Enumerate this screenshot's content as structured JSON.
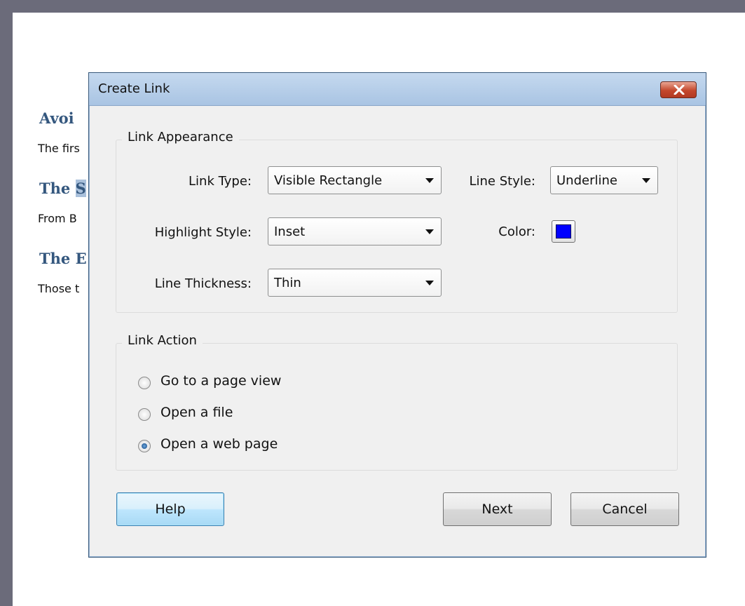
{
  "document": {
    "heading1": "Avoi",
    "para1": "The firs",
    "heading2_a": "The ",
    "heading2_sel": "S",
    "para2": "From B",
    "heading3": "The E",
    "para3": "Those t"
  },
  "dialog": {
    "title": "Create Link",
    "close_icon": "close-x-icon",
    "appearance": {
      "legend": "Link Appearance",
      "link_type_label": "Link Type:",
      "link_type_value": "Visible Rectangle",
      "line_style_label": "Line Style:",
      "line_style_value": "Underline",
      "highlight_style_label": "Highlight Style:",
      "highlight_style_value": "Inset",
      "color_label": "Color:",
      "color_value": "#0000ff",
      "line_thickness_label": "Line Thickness:",
      "line_thickness_value": "Thin"
    },
    "action": {
      "legend": "Link Action",
      "options": [
        {
          "label": "Go to a page view",
          "selected": false
        },
        {
          "label": "Open a file",
          "selected": false
        },
        {
          "label": "Open a web page",
          "selected": true
        }
      ]
    },
    "buttons": {
      "help": "Help",
      "next": "Next",
      "cancel": "Cancel"
    }
  },
  "colors": {
    "accent": "#3c7fb1",
    "heading_blue": "#34577e"
  }
}
